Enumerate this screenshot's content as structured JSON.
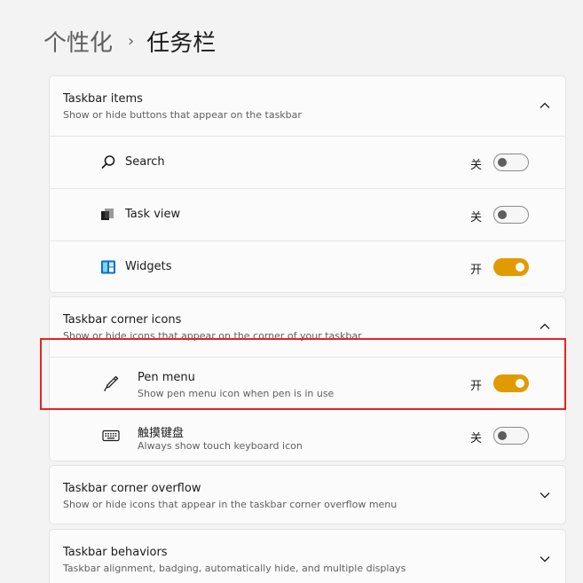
{
  "breadcrumb": {
    "parent": "个性化",
    "separator": "›",
    "current": "任务栏"
  },
  "taskbar_items": {
    "title": "Taskbar items",
    "desc": "Show or hide buttons that appear on the taskbar",
    "rows": [
      {
        "label": "Search",
        "state": "关",
        "on": false,
        "icon": "search-icon"
      },
      {
        "label": "Task view",
        "state": "关",
        "on": false,
        "icon": "task-view-icon"
      },
      {
        "label": "Widgets",
        "state": "开",
        "on": true,
        "icon": "widgets-icon"
      }
    ]
  },
  "corner_icons": {
    "title": "Taskbar corner icons",
    "desc": "Show or hide icons that appear on the corner of your taskbar",
    "rows": [
      {
        "label": "Pen menu",
        "sub": "Show pen menu icon when pen is in use",
        "state": "开",
        "on": true,
        "icon": "pen-icon"
      },
      {
        "label": "触摸键盘",
        "sub": "Always show touch keyboard icon",
        "state": "关",
        "on": false,
        "icon": "keyboard-icon"
      }
    ]
  },
  "corner_overflow": {
    "title": "Taskbar corner overflow",
    "desc": "Show or hide icons that appear in the taskbar corner overflow menu"
  },
  "behaviors": {
    "title": "Taskbar behaviors",
    "desc": "Taskbar alignment, badging, automatically hide, and multiple displays"
  },
  "colors": {
    "accent": "#e19b00",
    "highlight": "#e8231f",
    "background": "#f3f3f3"
  }
}
